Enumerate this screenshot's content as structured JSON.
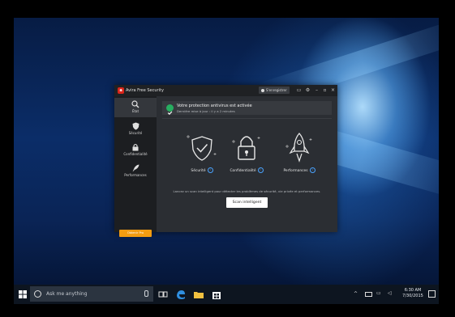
{
  "app": {
    "title": "Avira Free Security",
    "register_label": "S'enregistrer"
  },
  "sidebar": {
    "items": [
      {
        "label": "État",
        "icon": "search-icon"
      },
      {
        "label": "Sécurité",
        "icon": "shield-icon"
      },
      {
        "label": "Confidentialité",
        "icon": "lock-icon"
      },
      {
        "label": "Performances",
        "icon": "rocket-icon"
      }
    ],
    "upgrade_label": "Obtenir Pro"
  },
  "status": {
    "title": "Votre protection antivirus est activée",
    "subtitle": "Dernière mise à jour : il y a 2 minutes"
  },
  "features": [
    {
      "label": "Sécurité",
      "icon": "shield-check-icon"
    },
    {
      "label": "Confidentialité",
      "icon": "padlock-icon"
    },
    {
      "label": "Performances",
      "icon": "rocket-icon"
    }
  ],
  "hint": "Lancez un scan intelligent pour détecter les problèmes de sécurité, vie privée et performances.",
  "scan_button": "Scan intelligent",
  "taskbar": {
    "search_placeholder": "Ask me anything",
    "time": "6:30 AM",
    "date": "7/30/2015"
  },
  "colors": {
    "accent_red": "#d9261c",
    "status_green": "#27ae60",
    "upgrade_orange": "#f39c11",
    "info_blue": "#4aa3ff"
  }
}
